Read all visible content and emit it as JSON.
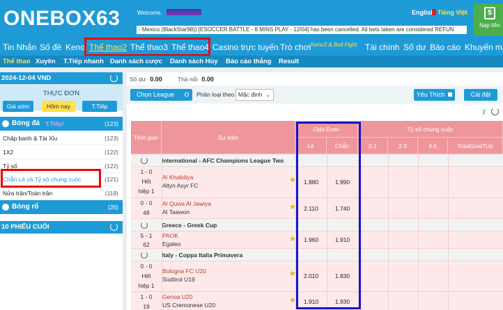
{
  "header": {
    "logo": "ONEBOX63",
    "welcome": "Welcome,",
    "lang_en": "English",
    "lang_vi": "Tiếng Việt",
    "deposit_label": "Nạp tiền",
    "ticker": "- Mexico (BlackStar98)) [ESOCCER BATTLE - 8 MINS PLAY - 12/04] has been cancelled. All bets taken are considered REFUN"
  },
  "mainnav": [
    {
      "label": "Tin Nhắn"
    },
    {
      "label": "Số đề"
    },
    {
      "label": "Keno"
    },
    {
      "label": "Thể thao2"
    },
    {
      "label": "Thể thao3"
    },
    {
      "label": "Thể thao4"
    },
    {
      "label": "Casino trực tuyến"
    },
    {
      "label": "Trò chơi"
    },
    {
      "label": "Keno3 & Bull Fight"
    },
    {
      "label": "Tài chính"
    },
    {
      "label": "Số dư"
    },
    {
      "label": "Báo cáo"
    },
    {
      "label": "Khuyến mã"
    }
  ],
  "subnav": [
    {
      "label": "Thể thao"
    },
    {
      "label": "Xuyên"
    },
    {
      "label": "T.Tiếp nhanh"
    },
    {
      "label": "Danh sách cược"
    },
    {
      "label": "Danh sách Hủy"
    },
    {
      "label": "Báo cáo thắng"
    },
    {
      "label": "Result"
    }
  ],
  "sidebar": {
    "date": "2024-12-04 VND",
    "menu_title": "THỰC ĐƠN",
    "day_buttons": [
      "Giá sớm",
      "Hôm nay",
      "T.Tiếp"
    ],
    "football": {
      "name": "Bóng đá",
      "tag": "T.Tiếp!",
      "count": "(123)"
    },
    "rows": [
      {
        "label": "Chấp banh & Tài Xỉu",
        "count": "(123)"
      },
      {
        "label": "1X2",
        "count": "(122)"
      },
      {
        "label": "Tỷ số",
        "count": "(122)"
      },
      {
        "label": "Chẵn Lẻ và Tỷ số chung cuộc",
        "count": "(121)"
      },
      {
        "label": "Nửa trận/Toàn trận",
        "count": "(119)"
      }
    ],
    "basketball": {
      "name": "Bóng rổ",
      "count": "(26)"
    },
    "last_tickets": "10 PHIẾU CUỐI"
  },
  "balance": {
    "label1": "Số dư",
    "value1": "0.00",
    "label2": "Thả nổi",
    "value2": "0.00"
  },
  "toolbar": {
    "choose_league": "Chọn League",
    "filter_label": "Phân loại theo",
    "select_value": "Mặc định",
    "favorite": "Yêu Thích",
    "settings": "Cài đặt",
    "count": "7"
  },
  "table": {
    "headers": {
      "time": "Thời gian",
      "event": "Sự kiện",
      "odd_even": "Odd Even",
      "le": "Lẻ",
      "chan": "Chẵn",
      "final_score": "Tỷ số chung cuộc",
      "c1": "0.1",
      "c2": "2.3",
      "c3": "4.6",
      "c4": "TotalGoal7Up"
    },
    "leagues": [
      {
        "name": "International - AFC Champions League Two",
        "matches": [
          {
            "score": "1 - 0",
            "status": "Hết",
            "period": "hiệp 1",
            "home": "Al Khalidiya",
            "away": "Altyn Asyr FC",
            "le": "1.880",
            "chan": "1.990"
          },
          {
            "score": "0 - 0",
            "status": "48",
            "period": "",
            "home": "Al Quwa Al Jawiya",
            "away": "Al Taawon",
            "le": "2.110",
            "chan": "1.740"
          }
        ]
      },
      {
        "name": "Greece - Greek Cup",
        "matches": [
          {
            "score": "5 - 1",
            "status": "62",
            "period": "",
            "home": "PAOK",
            "away": "Egaleo",
            "le": "1.960",
            "chan": "1.910"
          }
        ]
      },
      {
        "name": "Italy - Coppa Italia Primavera",
        "matches": [
          {
            "score": "0 - 0",
            "status": "Hết",
            "period": "hiệp 1",
            "home": "Bologna FC U20",
            "away": "Südtirol U19",
            "le": "2.010",
            "chan": "1.830"
          },
          {
            "score": "1 - 0",
            "status": "19",
            "period": "",
            "home": "Genoa U20",
            "away": "US Cremonese U20",
            "le": "1.910",
            "chan": "1.930"
          }
        ]
      }
    ]
  }
}
